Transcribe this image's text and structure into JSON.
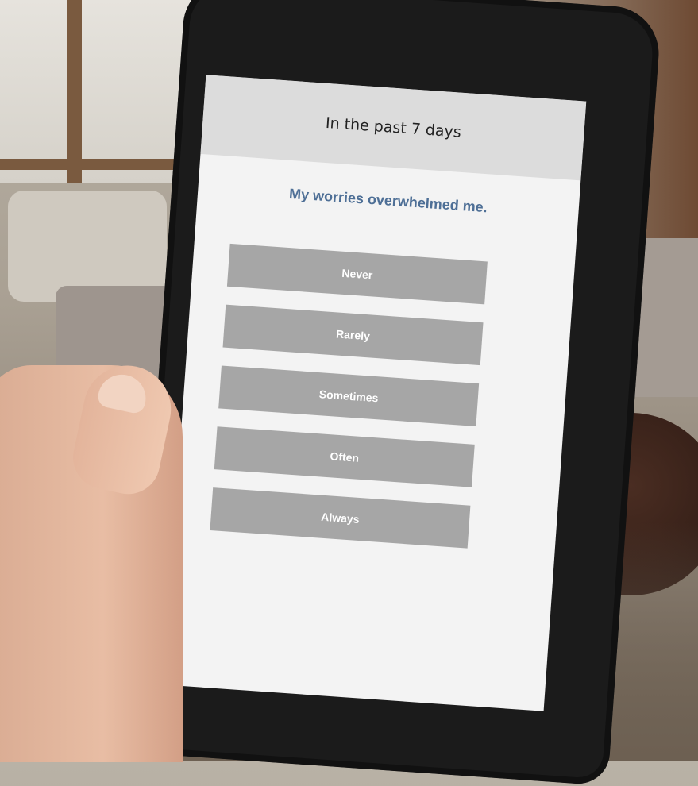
{
  "survey": {
    "header": "In the past 7 days",
    "question": "My worries overwhelmed me.",
    "options": [
      "Never",
      "Rarely",
      "Sometimes",
      "Often",
      "Always"
    ]
  },
  "colors": {
    "question_text": "#4e6f96",
    "option_background": "#a6a6a6",
    "header_background": "#dcdcdc"
  }
}
